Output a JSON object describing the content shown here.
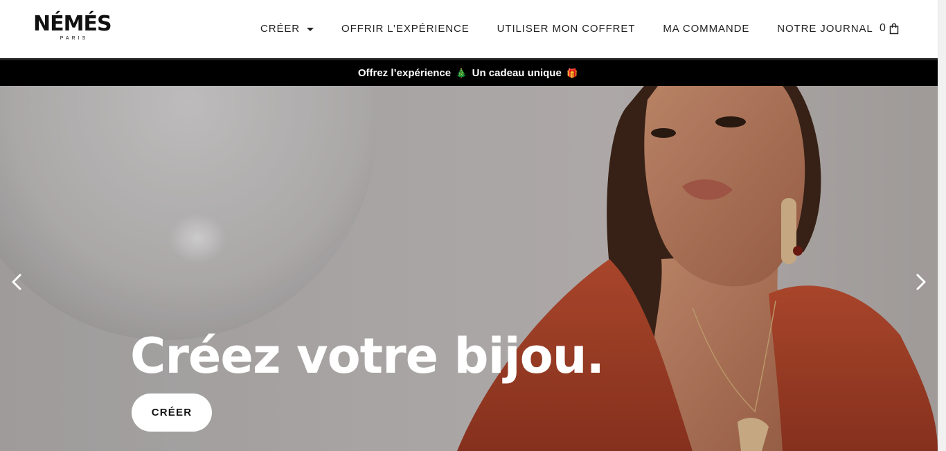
{
  "header": {
    "logo": {
      "wordmark": "NÉMÉS",
      "tagline": "PARIS"
    },
    "nav": [
      {
        "label": "CRÉER",
        "has_dropdown": true
      },
      {
        "label": "OFFRIR L’EXPÉRIENCE"
      },
      {
        "label": "UTILISER MON COFFRET"
      },
      {
        "label": "MA COMMANDE"
      },
      {
        "label": "NOTRE JOURNAL"
      }
    ],
    "cart": {
      "count": "0",
      "icon": "shopping-bag-icon"
    }
  },
  "announcement": {
    "text_1": "Offrez l’expérience",
    "emoji_1": "🎄",
    "text_2": "Un cadeau unique",
    "emoji_2": "🎁"
  },
  "hero": {
    "title": "Créez votre bijou.",
    "button_label": "CRÉER",
    "prev_icon": "chevron-left-icon",
    "next_icon": "chevron-right-icon"
  },
  "colors": {
    "header_bg": "#ffffff",
    "announcement_bg": "#000000",
    "hero_text": "#ffffff",
    "button_bg": "#ffffff",
    "dress": "#b0442a"
  }
}
